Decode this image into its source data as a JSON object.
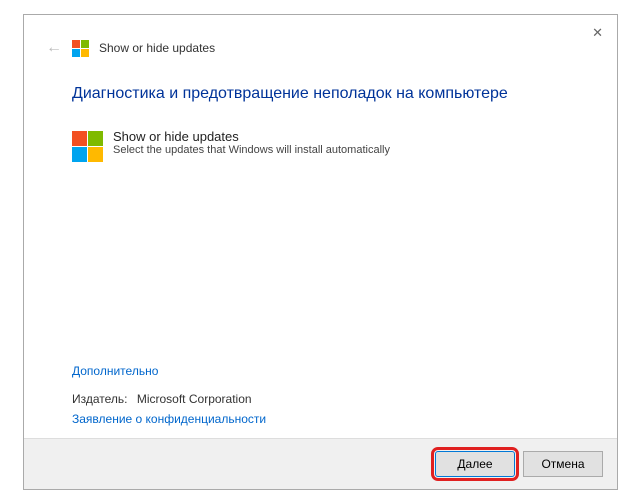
{
  "header": {
    "title": "Show or hide updates"
  },
  "main": {
    "heading": "Диагностика и предотвращение неполадок на компьютере",
    "option": {
      "title": "Show or hide updates",
      "description": "Select the updates that Windows will install automatically"
    }
  },
  "links": {
    "advanced": "Дополнительно",
    "privacy": "Заявление о конфиденциальности"
  },
  "publisher": {
    "label": "Издатель:",
    "value": "Microsoft Corporation"
  },
  "footer": {
    "next": "Далее",
    "cancel": "Отмена"
  }
}
